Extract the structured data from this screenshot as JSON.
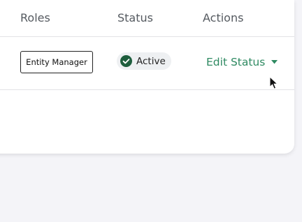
{
  "table": {
    "columns": {
      "roles": "Roles",
      "status": "Status",
      "actions": "Actions"
    },
    "rows": [
      {
        "role": "Entity Manager",
        "status": "Active",
        "action_label": "Edit Status"
      }
    ]
  },
  "icons": {
    "status": "check-circle-icon",
    "dropdown": "caret-down-icon"
  },
  "colors": {
    "accent": "#2f8a62",
    "status_active": "#1e5e3d",
    "page_background": "#f4f4f8"
  }
}
